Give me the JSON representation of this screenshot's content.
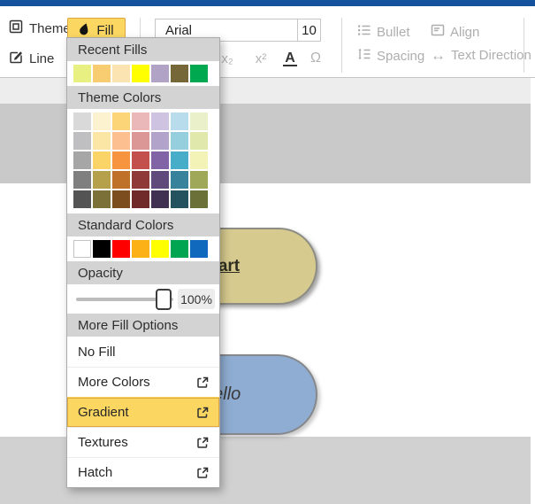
{
  "toolbar": {
    "themes": "Themes",
    "fill": "Fill",
    "line": "Line",
    "font_name": "Arial",
    "font_size": "10",
    "subscript": "x₂",
    "superscript": "x²",
    "font_color": "A",
    "symbol": "Ω",
    "bullet": "Bullet",
    "align": "Align",
    "spacing": "Spacing",
    "text_direction": "Text Direction"
  },
  "icons": {
    "text_direction_glyph": "↔"
  },
  "fill_panel": {
    "recent_fills_title": "Recent Fills",
    "recent_fills": [
      "#e7f080",
      "#f8cc71",
      "#fce3b2",
      "#ffff00",
      "#b1a3c6",
      "#756738",
      "#00a84f"
    ],
    "theme_colors_title": "Theme Colors",
    "theme_colors": [
      [
        "#d9d9d9",
        "#fdf2cf",
        "#fbd578",
        "#eab8b8",
        "#cec3e0",
        "#b9dcec",
        "#eaf0ca"
      ],
      [
        "#bfbfc1",
        "#fce6a5",
        "#fbbf90",
        "#db9795",
        "#b2a3cb",
        "#95cedd",
        "#e0e9ab"
      ],
      [
        "#a6a6a6",
        "#fbd467",
        "#f79440",
        "#c4504e",
        "#8164a5",
        "#48adc8",
        "#f3f3b7"
      ],
      [
        "#7f7f7f",
        "#b5a14c",
        "#bf7029",
        "#8f3a38",
        "#5f4a7b",
        "#38829b",
        "#9fa758"
      ],
      [
        "#545454",
        "#7a7038",
        "#7c4d1e",
        "#6f2a29",
        "#403152",
        "#24525f",
        "#6b7039"
      ]
    ],
    "standard_colors_title": "Standard Colors",
    "standard_colors": [
      "#ffffff",
      "#000000",
      "#fe0000",
      "#fcb216",
      "#ffff00",
      "#00a551",
      "#1169bd"
    ],
    "opacity_title": "Opacity",
    "opacity_value": "100%",
    "more_options_title": "More Fill Options",
    "options": [
      {
        "label": "No Fill",
        "external": false,
        "selected": false
      },
      {
        "label": "More Colors",
        "external": true,
        "selected": false
      },
      {
        "label": "Gradient",
        "external": true,
        "selected": true
      },
      {
        "label": "Textures",
        "external": true,
        "selected": false
      },
      {
        "label": "Hatch",
        "external": true,
        "selected": false
      }
    ],
    "highlight_color": "#fbd762",
    "highlight_border": "#dfa63d"
  },
  "canvas": {
    "shapes": [
      {
        "label": "Start",
        "fill": "#d6ca8e"
      },
      {
        "label": "Hello",
        "fill": "#8fadd2"
      }
    ]
  },
  "colors": {
    "top_accent_bar": "#15529e",
    "section_header_bg": "#d3d3d3"
  }
}
